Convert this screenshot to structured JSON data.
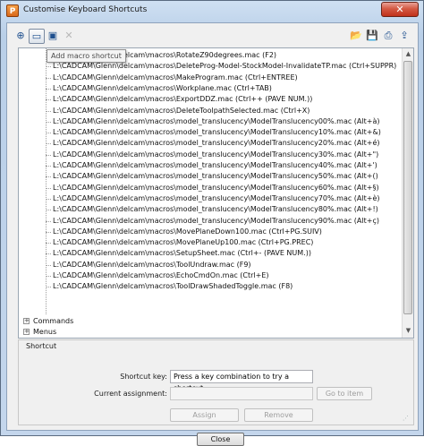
{
  "window": {
    "title": "Customise Keyboard Shortcuts",
    "app_icon_letter": "P",
    "close_glyph": "✕"
  },
  "toolbar": {
    "left_buttons": [
      {
        "name": "add-shortcut-icon",
        "glyph": "⊕"
      },
      {
        "name": "add-macro-shortcut-icon",
        "glyph": "▭"
      },
      {
        "name": "edit-shortcut-icon",
        "glyph": "▣"
      },
      {
        "name": "delete-shortcut-icon",
        "glyph": "✕"
      }
    ],
    "right_buttons": [
      {
        "name": "open-file-icon",
        "glyph": "📂"
      },
      {
        "name": "save-file-icon",
        "glyph": "💾"
      },
      {
        "name": "print-icon",
        "glyph": "⎙"
      },
      {
        "name": "export-icon",
        "glyph": "⇪"
      }
    ],
    "tooltip": "Add macro shortcut"
  },
  "tree": {
    "items": [
      "L:\\CADCAM\\Glenn\\delcam\\macros\\RotateZ90degrees.mac (F2)",
      "L:\\CADCAM\\Glenn\\delcam\\macros\\DeleteProg-Model-StockModel-InvalidateTP.mac (Ctrl+SUPPR)",
      "L:\\CADCAM\\Glenn\\delcam\\macros\\MakeProgram.mac (Ctrl+ENTREE)",
      "L:\\CADCAM\\Glenn\\delcam\\macros\\Workplane.mac (Ctrl+TAB)",
      "L:\\CADCAM\\Glenn\\delcam\\macros\\ExportDDZ.mac (Ctrl++ (PAVE NUM.))",
      "L:\\CADCAM\\Glenn\\delcam\\macros\\DeleteToolpathSelected.mac (Ctrl+X)",
      "L:\\CADCAM\\Glenn\\delcam\\macros\\model_translucency\\ModelTranslucency00%.mac (Alt+à)",
      "L:\\CADCAM\\Glenn\\delcam\\macros\\model_translucency\\ModelTranslucency10%.mac (Alt+&)",
      "L:\\CADCAM\\Glenn\\delcam\\macros\\model_translucency\\ModelTranslucency20%.mac (Alt+é)",
      "L:\\CADCAM\\Glenn\\delcam\\macros\\model_translucency\\ModelTranslucency30%.mac (Alt+\")",
      "L:\\CADCAM\\Glenn\\delcam\\macros\\model_translucency\\ModelTranslucency40%.mac (Alt+')",
      "L:\\CADCAM\\Glenn\\delcam\\macros\\model_translucency\\ModelTranslucency50%.mac (Alt+()",
      "L:\\CADCAM\\Glenn\\delcam\\macros\\model_translucency\\ModelTranslucency60%.mac (Alt+§)",
      "L:\\CADCAM\\Glenn\\delcam\\macros\\model_translucency\\ModelTranslucency70%.mac (Alt+è)",
      "L:\\CADCAM\\Glenn\\delcam\\macros\\model_translucency\\ModelTranslucency80%.mac (Alt+!)",
      "L:\\CADCAM\\Glenn\\delcam\\macros\\model_translucency\\ModelTranslucency90%.mac (Alt+ç)",
      "L:\\CADCAM\\Glenn\\delcam\\macros\\MovePlaneDown100.mac (Ctrl+PG.SUIV)",
      "L:\\CADCAM\\Glenn\\delcam\\macros\\MovePlaneUp100.mac (Ctrl+PG.PREC)",
      "L:\\CADCAM\\Glenn\\delcam\\macros\\SetupSheet.mac (Ctrl+- (PAVE NUM.))",
      "L:\\CADCAM\\Glenn\\delcam\\macros\\ToolUndraw.mac (F9)",
      "L:\\CADCAM\\Glenn\\delcam\\macros\\EchoCmdOn.mac (Ctrl+E)",
      "L:\\CADCAM\\Glenn\\delcam\\macros\\ToolDrawShadedToggle.mac (F8)"
    ],
    "groups": [
      {
        "label": "Commands",
        "expander": "+"
      },
      {
        "label": "Menus",
        "expander": "+"
      }
    ],
    "scroll_up": "▲",
    "scroll_down": "▼"
  },
  "shortcut": {
    "group_title": "Shortcut",
    "key_label": "Shortcut key:",
    "key_value": "Press a key combination to try a shortcut",
    "assignment_label": "Current assignment:",
    "assignment_value": "",
    "goto_label": "Go to item",
    "assign_label": "Assign",
    "remove_label": "Remove"
  },
  "footer": {
    "close_label": "Close"
  }
}
